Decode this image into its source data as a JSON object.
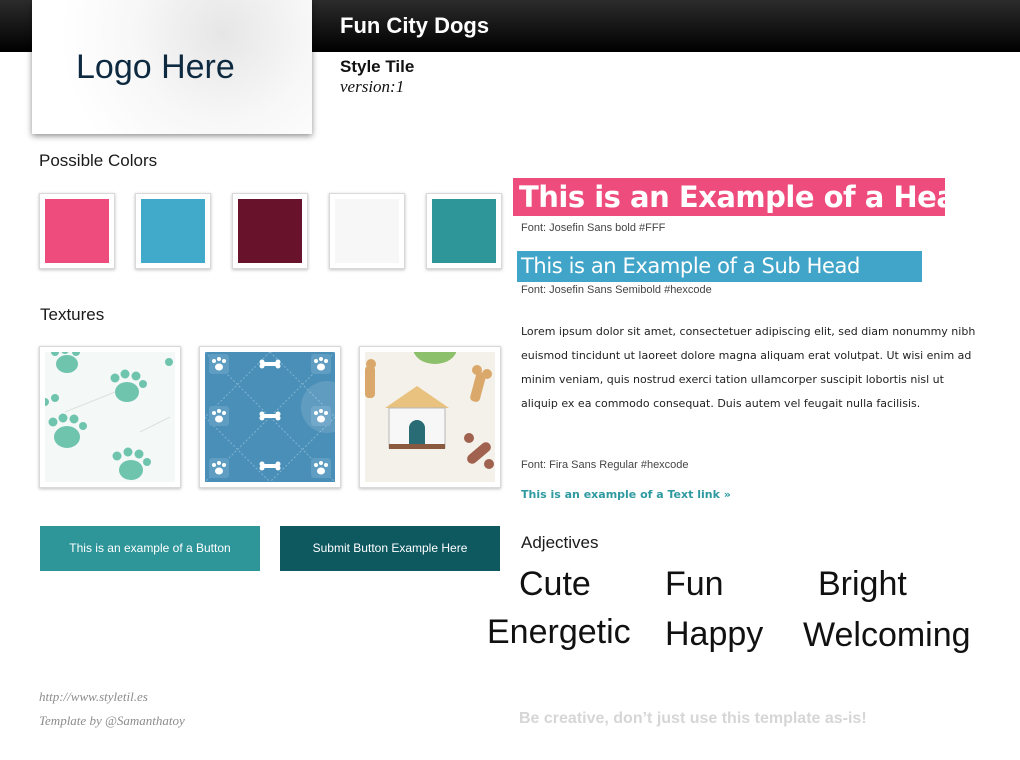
{
  "header": {
    "site_title": "Fun City Dogs"
  },
  "logo": {
    "text": "Logo Here"
  },
  "tile": {
    "label": "Style Tile",
    "version": "version:1"
  },
  "colors": {
    "title": "Possible Colors",
    "swatches": [
      "#ee4c7c",
      "#41a9c9",
      "#69122c",
      "#f7f7f7",
      "#2e9599"
    ]
  },
  "textures": {
    "title": "Textures",
    "items": [
      "paw-prints-texture-icon",
      "blue-paw-bone-texture-icon",
      "doghouse-bone-texture-icon"
    ]
  },
  "buttons": {
    "primary_label": "This is an example of a Button",
    "primary_color": "#2e9599",
    "submit_label": "Submit Button Example Here",
    "submit_color": "#0e5860"
  },
  "typography": {
    "header_text": "This is an Example of a Header",
    "header_font": "Font: Josefin Sans bold #FFF",
    "subhead_text": "This is an Example of a Sub Head",
    "subhead_font": "Font: Josefin Sans Semibold #hexcode",
    "body_text": "Lorem ipsum dolor sit amet, consectetuer adipiscing elit, sed diam nonummy nibh euismod tincidunt ut laoreet dolore magna aliquam erat volutpat. Ut wisi enim ad minim veniam, quis nostrud exerci tation ullamcorper suscipit lobortis nisl ut aliquip ex ea commodo consequat. Duis autem vel feugait nulla facilisis.",
    "body_font": "Font: Fira Sans Regular #hexcode",
    "link_text": "This is an example of a Text link »"
  },
  "adjectives": {
    "title": "Adjectives",
    "words": [
      "Cute",
      "Fun",
      "Bright",
      "Energetic",
      "Happy",
      "Welcoming"
    ]
  },
  "footer": {
    "credit_url": "http://www.styletil.es",
    "credit_author": "Template by @Samanthatoy",
    "note": "Be creative, don’t just use this template as-is!"
  }
}
